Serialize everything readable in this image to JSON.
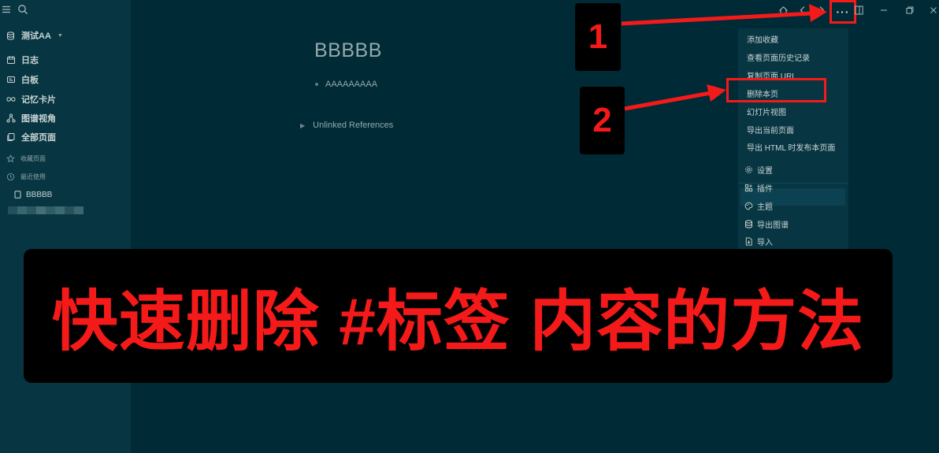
{
  "colors": {
    "bg": "#002b36",
    "sidebar": "#073642",
    "accent_red": "#f41a1a",
    "text": "#a6b8ba"
  },
  "sidebar": {
    "graph_name": "测试AA",
    "nav": [
      {
        "label": "日志",
        "icon": "calendar-icon"
      },
      {
        "label": "白板",
        "icon": "whiteboard-icon"
      },
      {
        "label": "记忆卡片",
        "icon": "infinity-icon"
      },
      {
        "label": "图谱视角",
        "icon": "graph-icon"
      },
      {
        "label": "全部页面",
        "icon": "pages-icon"
      }
    ],
    "favorites_label": "收藏页面",
    "recent_label": "最近使用",
    "recent_pages": [
      "BBBBB"
    ]
  },
  "page": {
    "title": "BBBBB",
    "blocks": [
      "AAAAAAAAA"
    ],
    "unlinked_references": "Unlinked References"
  },
  "toolbar": {
    "icons": [
      "home-icon",
      "back-icon",
      "forward-icon",
      "more-icon",
      "sidebar-toggle-icon",
      "minimize-icon",
      "maximize-icon",
      "close-icon"
    ],
    "more_label": "···"
  },
  "menu": {
    "items": [
      "添加收藏",
      "查看页面历史记录",
      "复制页面 URL",
      "删除本页",
      "幻灯片视图",
      "导出当前页面",
      "导出 HTML 时发布本页面"
    ],
    "bottom_items": [
      {
        "label": "设置",
        "icon": "gear-icon"
      },
      {
        "label": "插件",
        "icon": "plugins-icon"
      },
      {
        "label": "主题",
        "icon": "palette-icon"
      },
      {
        "label": "导出图谱",
        "icon": "database-icon"
      },
      {
        "label": "导入",
        "icon": "import-icon"
      }
    ]
  },
  "annotations": {
    "step1": "1",
    "step2": "2",
    "banner": "快速删除 #标签 内容的方法"
  }
}
